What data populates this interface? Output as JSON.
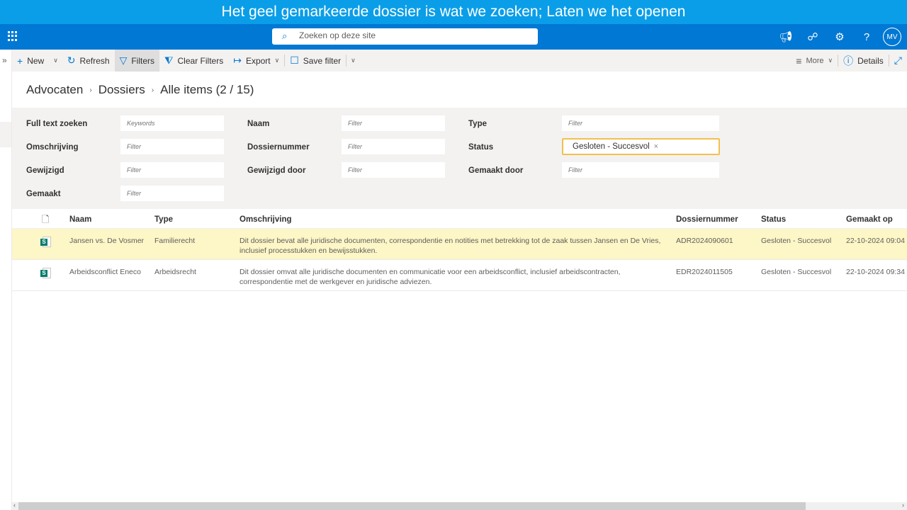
{
  "banner": {
    "text": "Het geel gemarkeerde dossier is wat we zoeken; Laten we het openen"
  },
  "suitebar": {
    "search_placeholder": "Zoeken op deze site",
    "avatar_initials": "MV"
  },
  "commandbar": {
    "new_label": "New",
    "refresh_label": "Refresh",
    "filters_label": "Filters",
    "clear_filters_label": "Clear Filters",
    "export_label": "Export",
    "save_filter_label": "Save filter",
    "more_label": "More",
    "details_label": "Details"
  },
  "breadcrumb": {
    "items": [
      "Advocaten",
      "Dossiers",
      "Alle items"
    ],
    "count": "(2 / 15)"
  },
  "filters": {
    "full_text": {
      "label": "Full text zoeken",
      "placeholder": "Keywords"
    },
    "omschrijving": {
      "label": "Omschrijving",
      "placeholder": "Filter"
    },
    "gewijzigd": {
      "label": "Gewijzigd",
      "placeholder": "Filter"
    },
    "gemaakt": {
      "label": "Gemaakt",
      "placeholder": "Filter"
    },
    "naam": {
      "label": "Naam",
      "placeholder": "Filter"
    },
    "dossiernummer": {
      "label": "Dossiernummer",
      "placeholder": "Filter"
    },
    "gewijzigd_door": {
      "label": "Gewijzigd door",
      "placeholder": "Filter"
    },
    "type": {
      "label": "Type",
      "placeholder": "Filter"
    },
    "status": {
      "label": "Status",
      "value": "Gesloten - Succesvol",
      "remove": "×"
    },
    "gemaakt_door": {
      "label": "Gemaakt door",
      "placeholder": "Filter"
    }
  },
  "table": {
    "columns": [
      "Naam",
      "Type",
      "Omschrijving",
      "Dossiernummer",
      "Status",
      "Gemaakt op"
    ],
    "rows": [
      {
        "naam": "Jansen vs. De Vosmer",
        "type": "Familierecht",
        "omschrijving_1": "Dit dossier bevat alle juridische documenten, correspondentie en notities met betrekking tot de zaak tussen Jansen en De Vries,",
        "omschrijving_2": "inclusief processtukken en bewijsstukken.",
        "dossiernummer": "ADR2024090601",
        "status": "Gesloten - Succesvol",
        "gemaakt_op": "22-10-2024 09:04",
        "highlighted": true
      },
      {
        "naam": "Arbeidsconflict Eneco",
        "type": "Arbeidsrecht",
        "omschrijving_1": "Dit dossier omvat alle juridische documenten en communicatie voor een arbeidsconflict, inclusief arbeidscontracten,",
        "omschrijving_2": "correspondentie met de werkgever en juridische adviezen.",
        "dossiernummer": "EDR2024011505",
        "status": "Gesloten - Succesvol",
        "gemaakt_op": "22-10-2024 09:34",
        "highlighted": false
      }
    ]
  },
  "colors": {
    "banner": "#0a9ee8",
    "suitebar": "#0078d4",
    "highlight": "#fdf6c6",
    "status_border": "#f2c14e"
  }
}
